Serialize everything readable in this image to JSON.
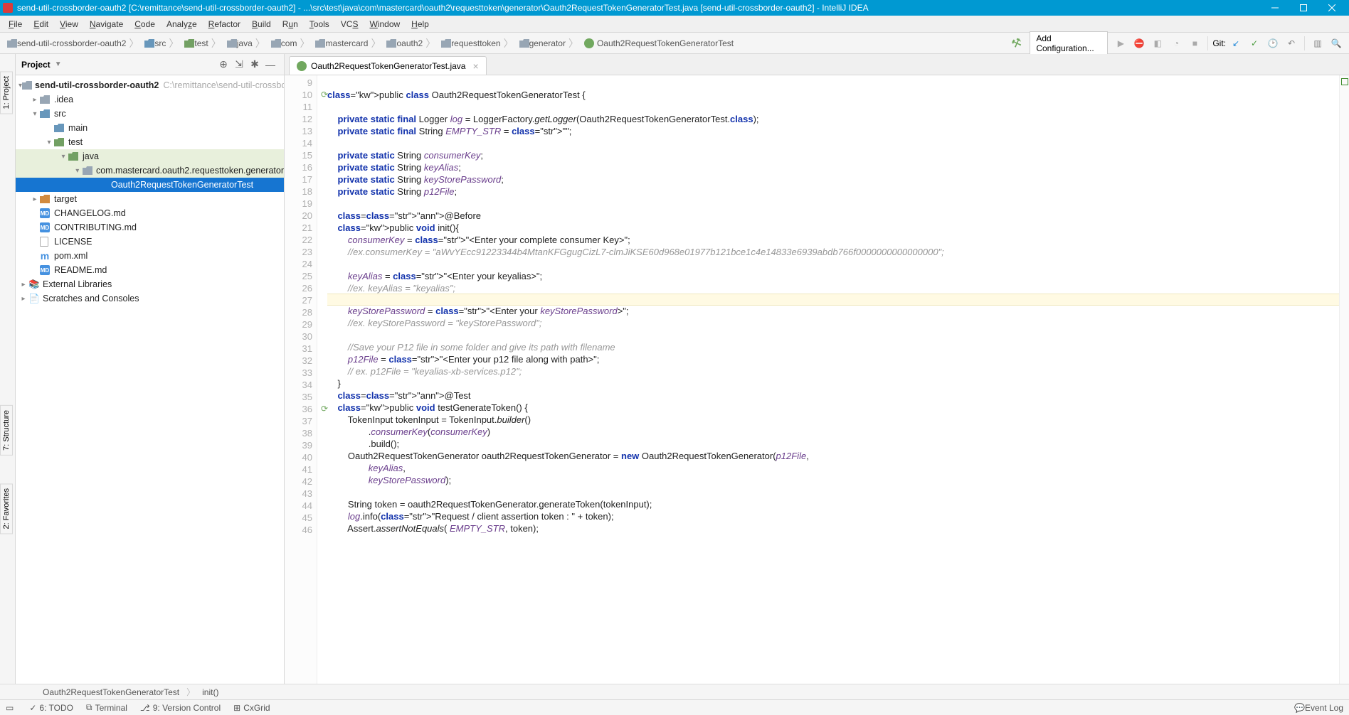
{
  "title_bar": {
    "text": "send-util-crossborder-oauth2 [C:\\remittance\\send-util-crossborder-oauth2] - ...\\src\\test\\java\\com\\mastercard\\oauth2\\requesttoken\\generator\\Oauth2RequestTokenGeneratorTest.java [send-util-crossborder-oauth2] - IntelliJ IDEA"
  },
  "menu": [
    "File",
    "Edit",
    "View",
    "Navigate",
    "Code",
    "Analyze",
    "Refactor",
    "Build",
    "Run",
    "Tools",
    "VCS",
    "Window",
    "Help"
  ],
  "nav": {
    "crumbs": [
      {
        "icon": "project",
        "label": "send-util-crossborder-oauth2"
      },
      {
        "icon": "folder-blue",
        "label": "src"
      },
      {
        "icon": "folder-green",
        "label": "test"
      },
      {
        "icon": "folder",
        "label": "java"
      },
      {
        "icon": "folder",
        "label": "com"
      },
      {
        "icon": "folder",
        "label": "mastercard"
      },
      {
        "icon": "folder",
        "label": "oauth2"
      },
      {
        "icon": "folder",
        "label": "requesttoken"
      },
      {
        "icon": "folder",
        "label": "generator"
      },
      {
        "icon": "class",
        "label": "Oauth2RequestTokenGeneratorTest"
      }
    ],
    "add_config": "Add Configuration...",
    "git_label": "Git:"
  },
  "project_panel": {
    "title": "Project",
    "root": {
      "label": "send-util-crossborder-oauth2",
      "hint": "C:\\remittance\\send-util-crossbo"
    },
    "tree": [
      {
        "label": ".idea",
        "indent": 1,
        "icon": "folder",
        "twisty": "▸"
      },
      {
        "label": "src",
        "indent": 1,
        "icon": "folder-blue",
        "twisty": "▾"
      },
      {
        "label": "main",
        "indent": 2,
        "icon": "folder-blue",
        "twisty": ""
      },
      {
        "label": "test",
        "indent": 2,
        "icon": "folder-green",
        "twisty": "▾"
      },
      {
        "label": "java",
        "indent": 3,
        "icon": "folder-green",
        "twisty": "▾",
        "active": true
      },
      {
        "label": "com.mastercard.oauth2.requesttoken.generator",
        "indent": 4,
        "icon": "folder",
        "twisty": "▾",
        "active": true
      },
      {
        "label": "Oauth2RequestTokenGeneratorTest",
        "indent": 5,
        "icon": "class",
        "selected": true
      },
      {
        "label": "target",
        "indent": 1,
        "icon": "folder-orange",
        "twisty": "▸"
      },
      {
        "label": "CHANGELOG.md",
        "indent": 1,
        "icon": "md"
      },
      {
        "label": "CONTRIBUTING.md",
        "indent": 1,
        "icon": "md"
      },
      {
        "label": "LICENSE",
        "indent": 1,
        "icon": "file"
      },
      {
        "label": "pom.xml",
        "indent": 1,
        "icon": "xml"
      },
      {
        "label": "README.md",
        "indent": 1,
        "icon": "md"
      }
    ],
    "ext_lib": "External Libraries",
    "scratches": "Scratches and Consoles"
  },
  "tab": {
    "label": "Oauth2RequestTokenGeneratorTest.java"
  },
  "line_start": 9,
  "code_lines": [
    "",
    "public class Oauth2RequestTokenGeneratorTest {",
    "",
    "    private static final Logger log = LoggerFactory.getLogger(Oauth2RequestTokenGeneratorTest.class);",
    "    private static final String EMPTY_STR = \"\";",
    "",
    "    private static String consumerKey;",
    "    private static String keyAlias;",
    "    private static String keyStorePassword;",
    "    private static String p12File;",
    "",
    "    @Before",
    "    public void init(){",
    "        consumerKey = \"<Enter your complete consumer Key>\";",
    "        //ex.consumerKey = \"aWvYEcc91223344b4MtanKFGgugCizL7-clmJiKSE60d968e01977b121bce1c4e14833e6939abdb766f0000000000000000\";",
    "",
    "        keyAlias = \"<Enter your keyalias>\";",
    "        //ex. keyAlias = \"keyalias\";",
    "",
    "        keyStorePassword = \"<Enter your keyStorePassword>\";",
    "        //ex. keyStorePassword = \"keyStorePassword\";",
    "",
    "        //Save your P12 file in some folder and give its path with filename",
    "        p12File = \"<Enter your p12 file along with path>\";",
    "        // ex. p12File = \"keyalias-xb-services.p12\";",
    "    }",
    "    @Test",
    "    public void testGenerateToken() {",
    "        TokenInput tokenInput = TokenInput.builder()",
    "                .consumerKey(consumerKey)",
    "                .build();",
    "        Oauth2RequestTokenGenerator oauth2RequestTokenGenerator = new Oauth2RequestTokenGenerator(p12File,",
    "                keyAlias,",
    "                keyStorePassword);",
    "",
    "        String token = oauth2RequestTokenGenerator.generateToken(tokenInput);",
    "        log.info(\"Request / client assertion token : \" + token);",
    "        Assert.assertNotEquals( EMPTY_STR, token);"
  ],
  "bottom_crumb": {
    "class": "Oauth2RequestTokenGeneratorTest",
    "method": "init()"
  },
  "status": {
    "todo": "6: TODO",
    "terminal": "Terminal",
    "vcs": "9: Version Control",
    "cxgrid": "CxGrid",
    "event_log": "Event Log"
  },
  "side_tabs": {
    "project": "1: Project",
    "structure": "7: Structure",
    "favorites": "2: Favorites"
  }
}
